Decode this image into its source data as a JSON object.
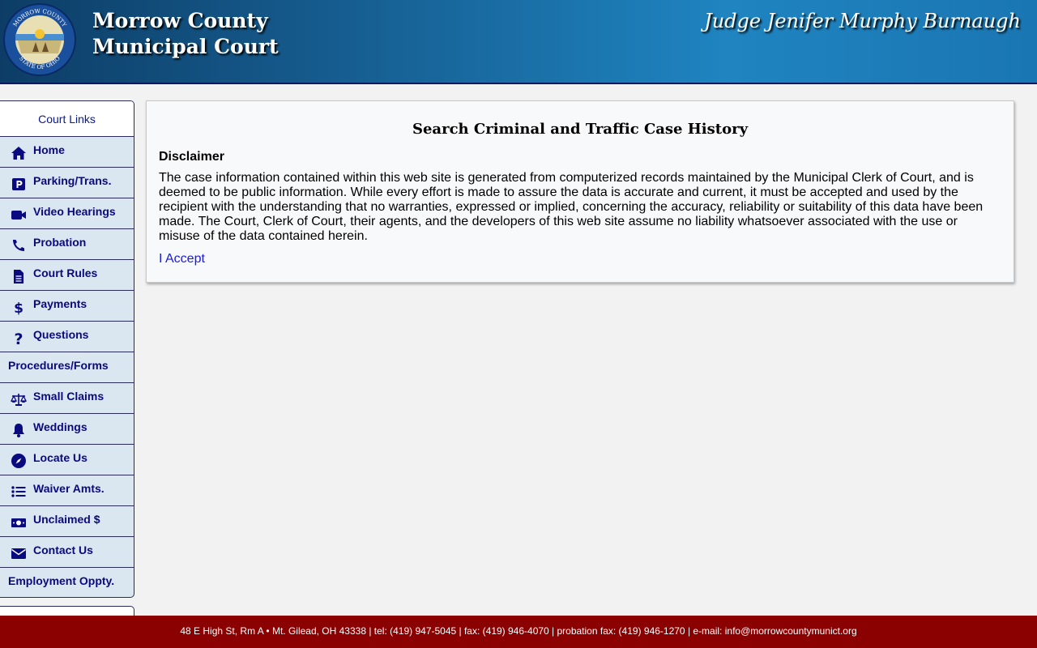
{
  "header": {
    "court_line1": "Morrow County",
    "court_line2": "Municipal Court",
    "judge": "Judge Jenifer Murphy Burnaugh",
    "seal_text_top": "MORROW COUNTY",
    "seal_text_bottom": "STATE OF OHIO"
  },
  "sidebar": {
    "title": "Court Links",
    "items": [
      {
        "label": "Home",
        "icon": "home-icon"
      },
      {
        "label": "Parking/Trans.",
        "icon": "parking-icon"
      },
      {
        "label": "Video Hearings",
        "icon": "video-icon"
      },
      {
        "label": "Probation",
        "icon": "phone-icon"
      },
      {
        "label": "Court Rules",
        "icon": "document-icon"
      },
      {
        "label": "Payments",
        "icon": "dollar-icon"
      },
      {
        "label": "Questions",
        "icon": "question-icon"
      },
      {
        "label": "Procedures/Forms",
        "icon": ""
      },
      {
        "label": "Small Claims",
        "icon": "scales-icon"
      },
      {
        "label": "Weddings",
        "icon": "bell-icon"
      },
      {
        "label": "Locate Us",
        "icon": "compass-icon"
      },
      {
        "label": "Waiver Amts.",
        "icon": "list-icon"
      },
      {
        "label": "Unclaimed $",
        "icon": "money-icon"
      },
      {
        "label": "Contact Us",
        "icon": "envelope-icon"
      },
      {
        "label": "Employment Oppty.",
        "icon": ""
      }
    ]
  },
  "main": {
    "title": "Search Criminal and Traffic Case History",
    "disclaimer_heading": "Disclaimer",
    "disclaimer_text": "The case information contained within this web site is generated from computerized records maintained by the Municipal Clerk of Court, and is deemed to be public information. While every effort is made to assure the data is accurate and current, it must be accepted and used by the recipient with the understanding that no warranties, expressed or implied, concerning the accuracy, reliability or suitability of this data have been made. The Court, Clerk of Court, their agents, and the developers of this web site assume no liability whatsoever associated with the use or misuse of the data contained herein.",
    "accept_label": "I Accept"
  },
  "footer": {
    "text": "48 E High St, Rm A • Mt. Gilead, OH 43338 | tel: (419) 947-5045 | fax: (419) 946-4070 | probation fax: (419) 946-1270 | e-mail: info@morrowcountymunict.org"
  },
  "colors": {
    "header_dark": "#0d3d66",
    "header_light": "#1f84c0",
    "nav_text": "#0a0a80",
    "nav_bg": "#dae6f0",
    "link": "#1a1ad8",
    "footer_bg": "#8b0000"
  }
}
